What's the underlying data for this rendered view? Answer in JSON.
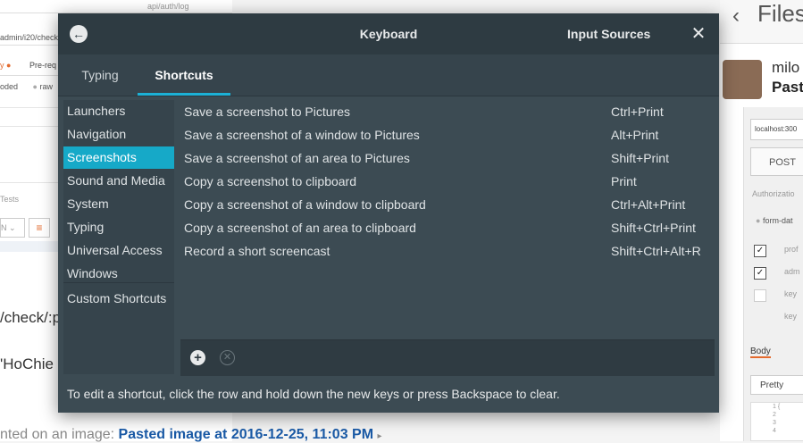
{
  "background": {
    "left": {
      "url_fragment": "api/auth/log",
      "url2": "admin/i20/check",
      "tabs": [
        "y ●",
        "Pre-req"
      ],
      "radio": [
        "oded",
        "raw"
      ],
      "tests": "Tests",
      "select": "N",
      "code_line1": "/check/:p",
      "code_line2": "'HoChie"
    },
    "bottom": {
      "prefix": "nted on an image:",
      "link": "Pasted image at 2016-12-25, 11:03 PM"
    },
    "right": {
      "title": "Files",
      "user": "milo",
      "pasted": "Past",
      "url": "localhost:300",
      "method": "POST",
      "auth": "Authorizatio",
      "form": "form-dat",
      "params": [
        {
          "checked": true,
          "key": "prof"
        },
        {
          "checked": true,
          "key": "adm"
        },
        {
          "checked": false,
          "key": "key"
        },
        {
          "checked": false,
          "key": "key"
        }
      ],
      "body_tab": "Body",
      "pretty": "Pretty",
      "code_lines": [
        "1 {",
        "2",
        "3",
        "4"
      ]
    }
  },
  "dialog": {
    "title": "Keyboard",
    "input_sources": "Input Sources",
    "tabs": [
      {
        "label": "Typing",
        "active": false
      },
      {
        "label": "Shortcuts",
        "active": true
      }
    ],
    "categories": [
      {
        "label": "Launchers",
        "active": false
      },
      {
        "label": "Navigation",
        "active": false
      },
      {
        "label": "Screenshots",
        "active": true
      },
      {
        "label": "Sound and Media",
        "active": false
      },
      {
        "label": "System",
        "active": false
      },
      {
        "label": "Typing",
        "active": false
      },
      {
        "label": "Universal Access",
        "active": false
      },
      {
        "label": "Windows",
        "active": false
      }
    ],
    "custom_shortcuts": "Custom Shortcuts",
    "shortcuts": [
      {
        "name": "Save a screenshot to Pictures",
        "accel": "Ctrl+Print"
      },
      {
        "name": "Save a screenshot of a window to Pictures",
        "accel": "Alt+Print"
      },
      {
        "name": "Save a screenshot of an area to Pictures",
        "accel": "Shift+Print"
      },
      {
        "name": "Copy a screenshot to clipboard",
        "accel": "Print"
      },
      {
        "name": "Copy a screenshot of a window to clipboard",
        "accel": "Ctrl+Alt+Print"
      },
      {
        "name": "Copy a screenshot of an area to clipboard",
        "accel": "Shift+Ctrl+Print"
      },
      {
        "name": "Record a short screencast",
        "accel": "Shift+Ctrl+Alt+R"
      }
    ],
    "hint": "To edit a shortcut, click the row and hold down the new keys or press Backspace to clear.",
    "colors": {
      "accent": "#16a9c8",
      "background": "#3c4b53",
      "titlebar": "#2e3b42"
    }
  }
}
